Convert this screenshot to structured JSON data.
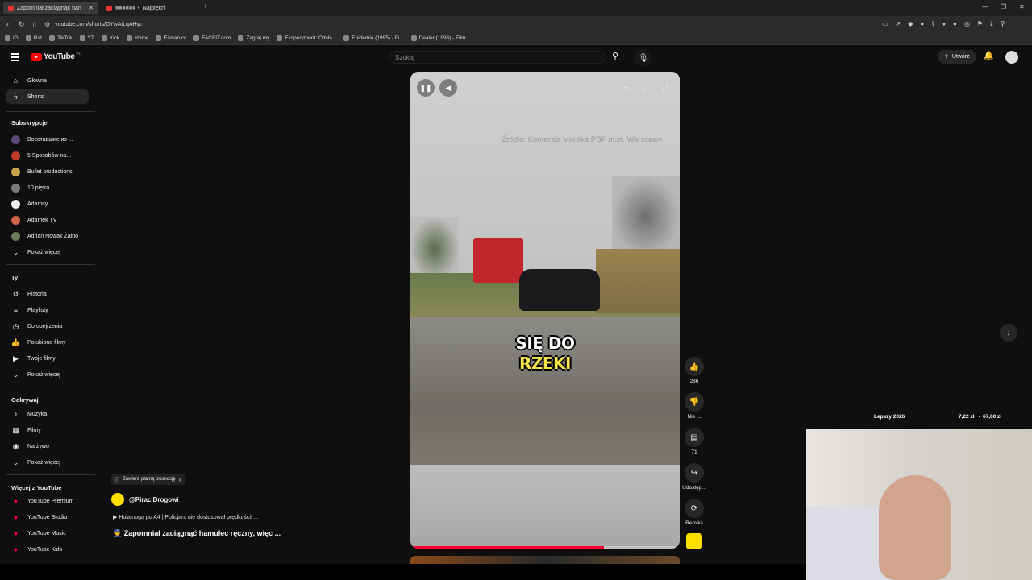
{
  "browser": {
    "tabs": [
      {
        "label": "Zapomniał zaciągnąć han",
        "active": true
      },
      {
        "label": "Najpiękni",
        "active": false
      }
    ],
    "url": "youtube.com/shorts/DYwAiLqAHyc",
    "bookmarks": [
      "IG",
      "Rat",
      "TikTok",
      "YT",
      "Kick",
      "Home",
      "Filman.cc",
      "FACEIT.com",
      "Zagraj.my",
      "Eksperyment: Odsła...",
      "Epidemia (1995) - Fi...",
      "Dealer (1996) - Film..."
    ]
  },
  "masthead": {
    "logo": "YouTube",
    "logo_region": "PL",
    "search_placeholder": "Szukaj",
    "create_label": "Utwórz"
  },
  "sidebar": {
    "main": [
      {
        "label": "Główna",
        "icon": "home-icon"
      },
      {
        "label": "Shorts",
        "icon": "shorts-icon",
        "active": true
      }
    ],
    "subs_heading": "Subskrypcje",
    "subs": [
      {
        "label": "Восставшие из ...",
        "color": "#5a4a7a"
      },
      {
        "label": "5 Sposobów na...",
        "color": "#c23a2a"
      },
      {
        "label": "Bullet productions",
        "color": "#c9a24a"
      },
      {
        "label": "10 piętro",
        "color": "#7a7a7a"
      },
      {
        "label": "Adamcy",
        "color": "#eeeeee"
      },
      {
        "label": "Adamek TV",
        "color": "#d0644a"
      },
      {
        "label": "Adrian Nowak Żalno",
        "color": "#6a7a5a"
      }
    ],
    "show_more": "Pokaż więcej",
    "you_heading": "Ty",
    "you": [
      {
        "label": "Historia",
        "icon": "history-icon"
      },
      {
        "label": "Playlisty",
        "icon": "playlist-icon"
      },
      {
        "label": "Do obejrzenia",
        "icon": "clock-icon"
      },
      {
        "label": "Polubione filmy",
        "icon": "like-icon"
      },
      {
        "label": "Twoje filmy",
        "icon": "video-icon"
      }
    ],
    "explore_heading": "Odkrywaj",
    "explore": [
      {
        "label": "Muzyka",
        "icon": "music-icon"
      },
      {
        "label": "Filmy",
        "icon": "film-icon"
      },
      {
        "label": "Na żywo",
        "icon": "live-icon"
      }
    ],
    "more_heading": "Więcej z YouTube",
    "more": [
      {
        "label": "YouTube Premium"
      },
      {
        "label": "YouTube Studio"
      },
      {
        "label": "YouTube Music"
      },
      {
        "label": "YouTube Kids"
      }
    ]
  },
  "player": {
    "source_text": "Źródło: Komenda Miejska PSP m.st. Warszawy",
    "caption_line1": "SIĘ DO",
    "caption_line2": "RZEKI",
    "progress": 0.72
  },
  "actions": {
    "likes": "286",
    "dislike": "Nie ...",
    "comments": "71",
    "share": "Udostęp...",
    "remix": "Remiks"
  },
  "info": {
    "promo": "Zawiera płatną promocję",
    "channel": "@PiraciDrogowi",
    "related": "Hulajnogą po A4 | Policjant nie dostosował prędkości! ...",
    "title": "Zapomniał zaciągnąć hamulec ręczny, więc ..."
  },
  "overlay": {
    "label": "Lepszy 2026",
    "amount": "7,22 zł",
    "goal": "67,00 zł"
  }
}
